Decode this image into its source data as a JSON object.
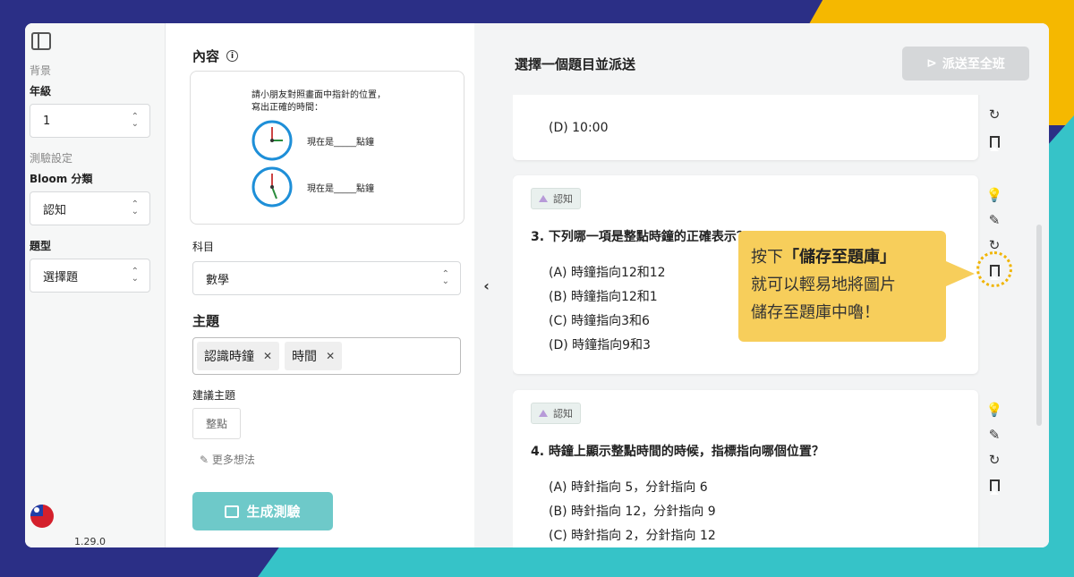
{
  "sidebar": {
    "section_background": "背景",
    "grade_label": "年級",
    "grade_value": "1",
    "section_quiz": "測驗設定",
    "bloom_label": "Bloom 分類",
    "bloom_value": "認知",
    "type_label": "題型",
    "type_value": "選擇題",
    "version": "1.29.0"
  },
  "middle": {
    "content_title": "內容",
    "preview": {
      "line1": "請小朋友對照畫面中指針的位置，",
      "line2": "寫出正確的時間：",
      "clock_label": "現在是_____點鐘"
    },
    "subject_label": "科目",
    "subject_value": "數學",
    "topic_label": "主題",
    "tags": [
      "認識時鐘",
      "時間"
    ],
    "suggest_label": "建議主題",
    "suggest_chip": "整點",
    "more_ideas": "更多想法",
    "generate_button": "生成測驗"
  },
  "right": {
    "title": "選擇一個題目並派送",
    "send_button": "派送至全班",
    "card_top_option": "(D) 10:00",
    "q3": {
      "badge": "認知",
      "question": "3.  下列哪一項是整點時鐘的正確表示？",
      "options": [
        "(A) 時鐘指向12和12",
        "(B) 時鐘指向12和1",
        "(C) 時鐘指向3和6",
        "(D) 時鐘指向9和3"
      ]
    },
    "q4": {
      "badge": "認知",
      "question": "4.  時鐘上顯示整點時間的時候，指標指向哪個位置？",
      "options": [
        "(A) 時針指向 5，分針指向 6",
        "(B) 時針指向 12，分針指向 9",
        "(C) 時針指向 2，分針指向 12"
      ]
    }
  },
  "callout": {
    "line1_prefix": "按下",
    "line1_bold": "「儲存至題庫」",
    "line2": "就可以輕易地將圖片",
    "line3": "儲存至題庫中嚕！"
  },
  "colors": {
    "background": "#2b2f86",
    "accent_teal": "#6ec9c9",
    "callout": "#f7ce5b",
    "highlight": "#f0b400"
  }
}
